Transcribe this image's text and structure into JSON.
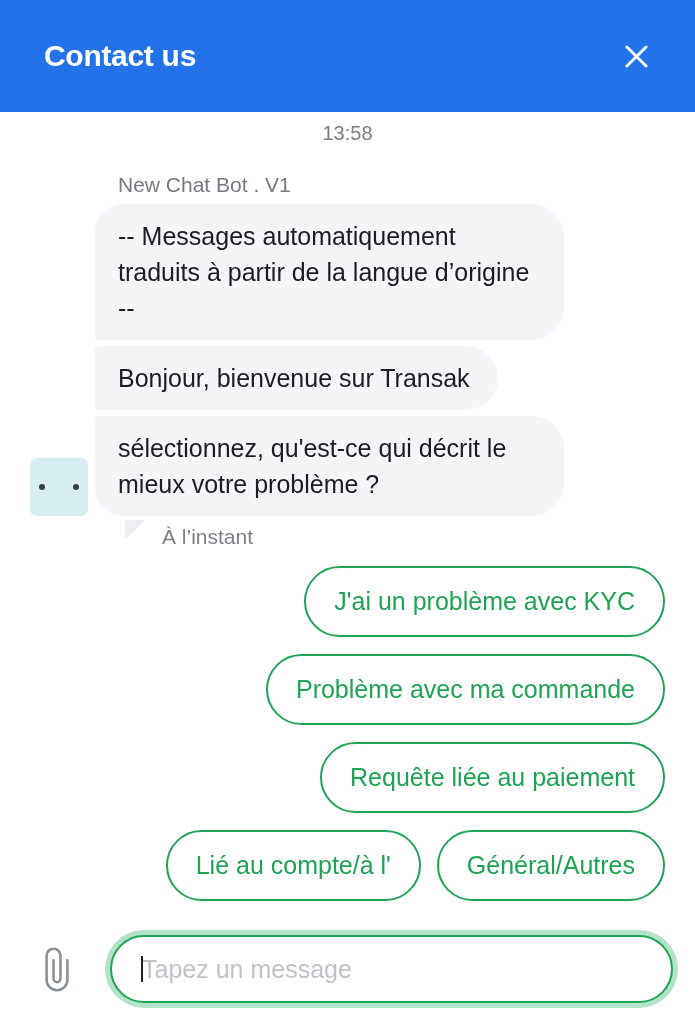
{
  "header": {
    "title": "Contact us"
  },
  "chat": {
    "timestamp": "13:58",
    "sender": "New Chat Bot . V1",
    "messages": [
      "-- Messages automatiquement traduits à partir de la langue d’origine --",
      "Bonjour, bienvenue sur Transak",
      "sélectionnez, qu'est-ce qui décrit le mieux votre problème ?"
    ],
    "status": "À l’instant"
  },
  "quick_replies": [
    "J'ai un problème avec KYC",
    "Problème avec ma commande",
    "Requête liée au paiement",
    "Lié au compte/à l'",
    "Général/Autres"
  ],
  "composer": {
    "placeholder": "Tapez un message"
  }
}
